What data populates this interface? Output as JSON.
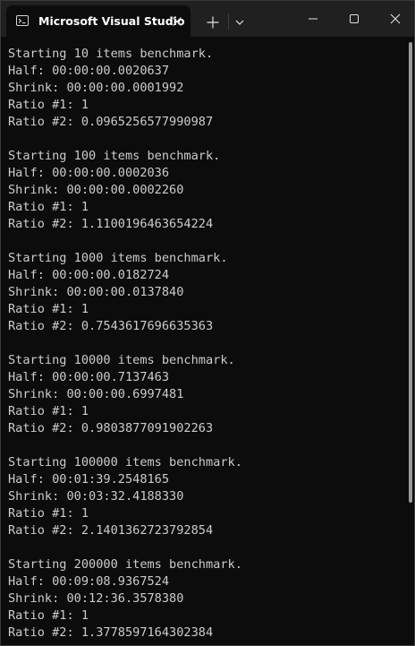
{
  "window": {
    "tab_title": "Microsoft Visual Studio",
    "icons": {
      "tab": "terminal-icon",
      "close_tab": "close-icon",
      "new_tab": "plus-icon",
      "dropdown": "chevron-down-icon",
      "minimize": "minimize-icon",
      "maximize": "maximize-icon",
      "close_window": "close-icon"
    }
  },
  "terminal": {
    "lines": [
      "Starting 10 items benchmark.",
      "Half: 00:00:00.0020637",
      "Shrink: 00:00:00.0001992",
      "Ratio #1: 1",
      "Ratio #2: 0.0965256577990987",
      "",
      "Starting 100 items benchmark.",
      "Half: 00:00:00.0002036",
      "Shrink: 00:00:00.0002260",
      "Ratio #1: 1",
      "Ratio #2: 1.1100196463654224",
      "",
      "Starting 1000 items benchmark.",
      "Half: 00:00:00.0182724",
      "Shrink: 00:00:00.0137840",
      "Ratio #1: 1",
      "Ratio #2: 0.7543617696635363",
      "",
      "Starting 10000 items benchmark.",
      "Half: 00:00:00.7137463",
      "Shrink: 00:00:00.6997481",
      "Ratio #1: 1",
      "Ratio #2: 0.9803877091902263",
      "",
      "Starting 100000 items benchmark.",
      "Half: 00:01:39.2548165",
      "Shrink: 00:03:32.4188330",
      "Ratio #1: 1",
      "Ratio #2: 2.1401362723792854",
      "",
      "Starting 200000 items benchmark.",
      "Half: 00:09:08.9367524",
      "Shrink: 00:12:36.3578380",
      "Ratio #1: 1",
      "Ratio #2: 1.3778597164302384"
    ]
  },
  "colors": {
    "background": "#0c0c0c",
    "titlebar": "#202020",
    "text": "#cccccc"
  }
}
